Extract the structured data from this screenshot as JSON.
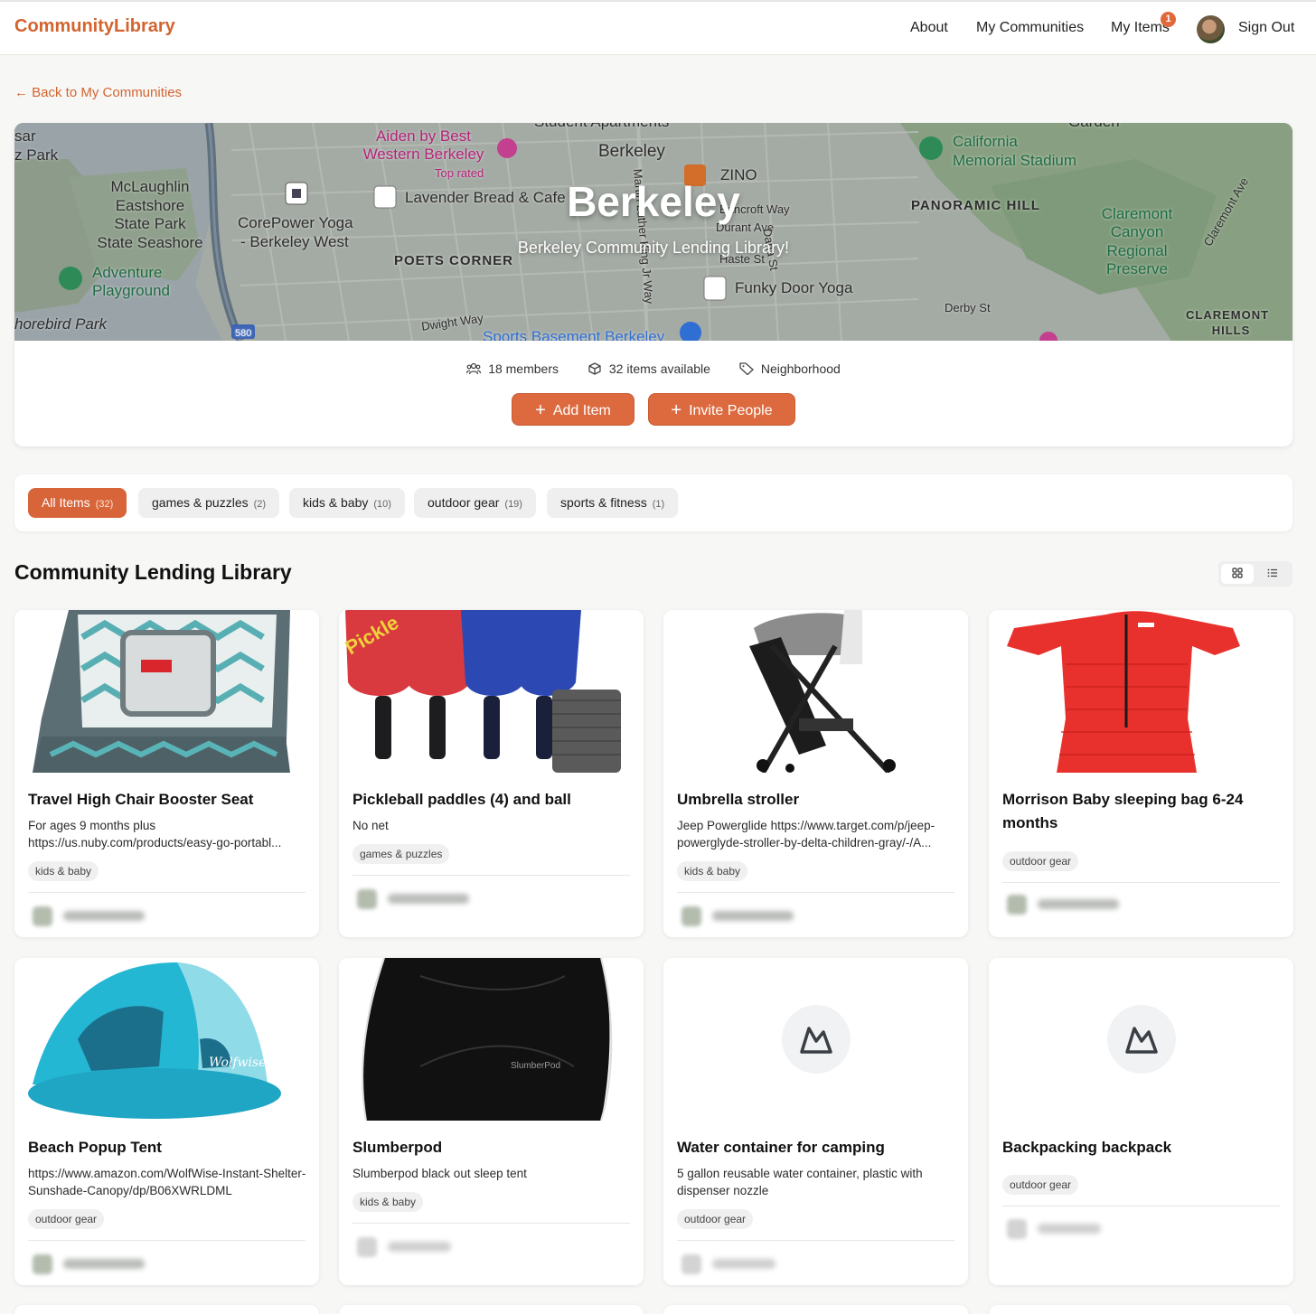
{
  "nav": {
    "brand": "CommunityLibrary",
    "about": "About",
    "my_communities": "My Communities",
    "my_items": "My Items",
    "my_items_badge": "1",
    "sign_out": "Sign Out"
  },
  "back_link": "← Back to My Communities",
  "community": {
    "name": "Berkeley",
    "subtitle": "Berkeley Community Lending Library!",
    "members": "18 members",
    "items_available": "32 items available",
    "type": "Neighborhood",
    "add_item_label": "Add Item",
    "invite_label": "Invite People"
  },
  "map_labels": [
    "sar",
    "z Park",
    "McLaughlin",
    "Eastshore",
    "State Park",
    "State Seashore",
    "Adventure",
    "Playground",
    "horebird Park",
    "580",
    "Aiden by Best",
    "Western Berkeley",
    "Top rated",
    "CorePower Yoga",
    "- Berkeley West",
    "Lavender Bread & Cafe",
    "POETS CORNER",
    "Berkeley",
    "ZINO",
    "Bancroft Way",
    "Durant Ave",
    "Haste St",
    "Dana St",
    "Martin Luther King Jr Way",
    "Funky Door Yoga",
    "Dwight Way",
    "Sports Basement Berkeley",
    "California",
    "Memorial Stadium",
    "PANORAMIC HILL",
    "Claremont",
    "Canyon",
    "Regional",
    "Preserve",
    "Claremont Ave",
    "Derby St",
    "CLAREMONT",
    "HILLS",
    "Student Apartments",
    "Garden"
  ],
  "filters": [
    {
      "label": "All Items",
      "count": "(32)",
      "active": true
    },
    {
      "label": "games & puzzles",
      "count": "(2)",
      "active": false
    },
    {
      "label": "kids & baby",
      "count": "(10)",
      "active": false
    },
    {
      "label": "outdoor gear",
      "count": "(19)",
      "active": false
    },
    {
      "label": "sports & fitness",
      "count": "(1)",
      "active": false
    }
  ],
  "section_title": "Community Lending Library",
  "view_toggle": {
    "grid_icon": "grid-icon",
    "list_icon": "list-icon"
  },
  "items": [
    {
      "title": "Travel High Chair Booster Seat",
      "desc": "For ages 9 months plus\nhttps://us.nuby.com/products/easy-go-portabl...",
      "tag": "kids & baby",
      "image": "booster-seat-image"
    },
    {
      "title": "Pickleball paddles (4) and ball",
      "desc": "No net",
      "tag": "games & puzzles",
      "image": "pickleball-paddles-image"
    },
    {
      "title": "Umbrella stroller",
      "desc": "Jeep Powerglide https://www.target.com/p/jeep-powerglyde-stroller-by-delta-children-gray/-/A...",
      "tag": "kids & baby",
      "image": "stroller-image"
    },
    {
      "title": "Morrison Baby sleeping bag 6-24 months",
      "desc": "",
      "tag": "outdoor gear",
      "image": "sleeping-bag-image"
    },
    {
      "title": "Beach Popup Tent",
      "desc": "https://www.amazon.com/WolfWise-Instant-Shelter-Sunshade-Canopy/dp/B06XWRLDML",
      "tag": "outdoor gear",
      "image": "beach-tent-image"
    },
    {
      "title": "Slumberpod",
      "desc": "Slumberpod black out sleep tent",
      "tag": "kids & baby",
      "image": "slumberpod-image"
    },
    {
      "title": "Water container for camping",
      "desc": "5 gallon reusable water container, plastic with dispenser nozzle",
      "tag": "outdoor gear",
      "image": "mountain-placeholder-icon"
    },
    {
      "title": "Backpacking backpack",
      "desc": "",
      "tag": "outdoor gear",
      "image": "mountain-placeholder-icon"
    }
  ],
  "colors": {
    "accent": "#d8653a",
    "brand": "#d3642f",
    "chip_bg": "#efefef",
    "page_bg": "#f7f7f6"
  }
}
